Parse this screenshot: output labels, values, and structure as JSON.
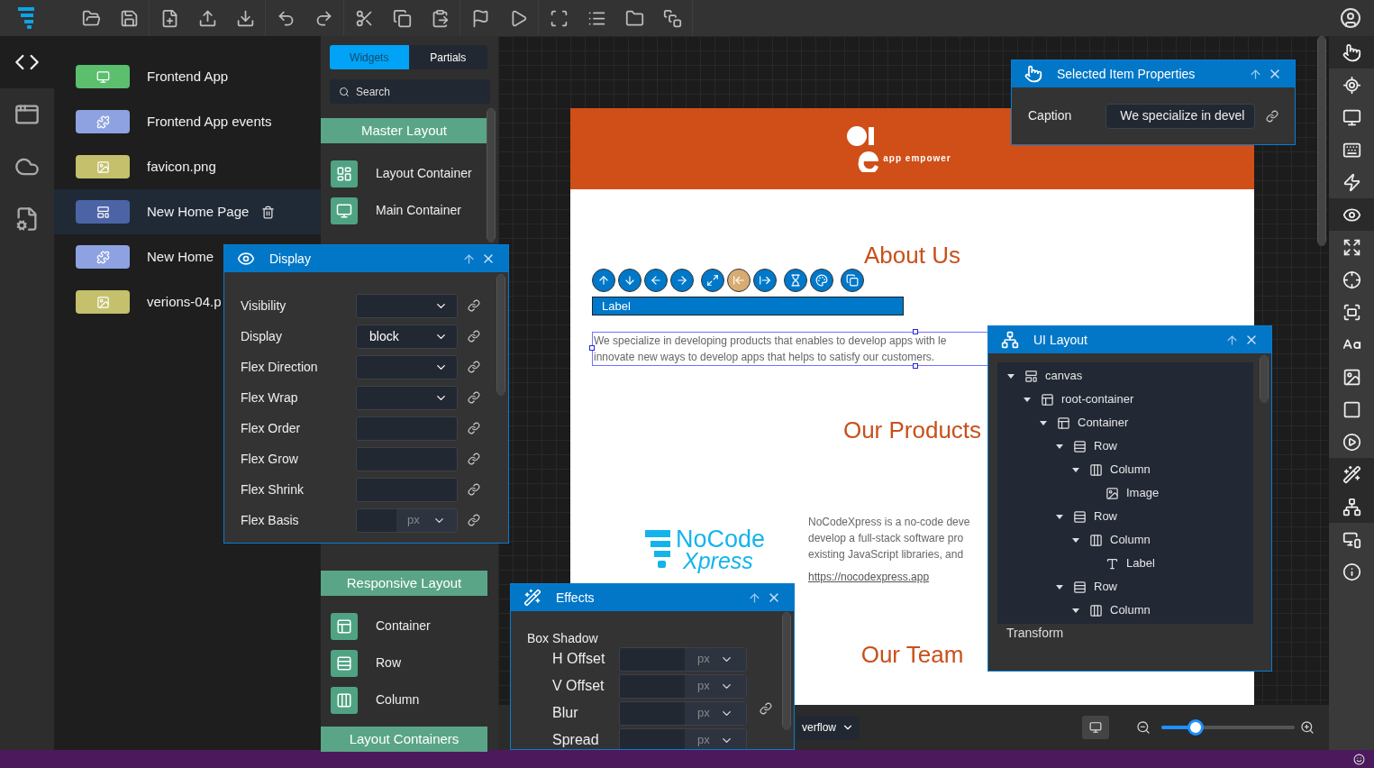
{
  "left_rail": [
    {
      "kind": "code",
      "selected": true
    },
    {
      "kind": "api",
      "selected": false
    },
    {
      "kind": "cloud",
      "selected": false
    },
    {
      "kind": "settings",
      "selected": false
    }
  ],
  "files": [
    {
      "name": "Frontend App",
      "kind": "app",
      "color": "#5cbf6e",
      "selected": false
    },
    {
      "name": "Frontend App events",
      "kind": "events",
      "color": "#8ea2e2",
      "selected": false
    },
    {
      "name": "favicon.png",
      "kind": "image",
      "color": "#c4c06c",
      "selected": false
    },
    {
      "name": "New Home Page",
      "kind": "page",
      "color": "#4c64a6",
      "selected": true
    },
    {
      "name": "New Home",
      "kind": "events",
      "color": "#8ea2e2",
      "selected": false
    },
    {
      "name": "verions-04.p",
      "kind": "image",
      "color": "#c4c06c",
      "selected": false
    }
  ],
  "palette": {
    "tabs": [
      {
        "label": "Widgets",
        "selected": true
      },
      {
        "label": "Partials",
        "selected": false
      }
    ],
    "search": {
      "placeholder": "Search"
    },
    "sections": [
      {
        "title": "Master Layout",
        "items": [
          {
            "label": "Layout Container",
            "kind": "layout"
          },
          {
            "label": "Main Container",
            "kind": "main"
          }
        ]
      },
      {
        "title": "Responsive Layout",
        "items": [
          {
            "label": "Container",
            "kind": "container"
          },
          {
            "label": "Row",
            "kind": "row"
          },
          {
            "label": "Column",
            "kind": "column"
          }
        ]
      },
      {
        "title": "Layout Containers"
      }
    ]
  },
  "page": {
    "brand": "app empower",
    "about_heading": "About Us",
    "element_tools": [
      {
        "kind": "up",
        "active": false
      },
      {
        "kind": "down",
        "active": false
      },
      {
        "kind": "left",
        "active": false
      },
      {
        "kind": "right",
        "active": false
      },
      {
        "kind": "resize",
        "active": false
      },
      {
        "kind": "shrink",
        "active": true
      },
      {
        "kind": "grow",
        "active": false
      },
      {
        "kind": "hourglass",
        "active": false
      },
      {
        "kind": "palette",
        "active": false
      },
      {
        "kind": "copy",
        "active": false
      }
    ],
    "label": "Label",
    "paragraph_lines": [
      "We specialize in developing products that enables to develop apps with le",
      "innovate new ways to develop apps that helps to satisfy our customers."
    ],
    "products_heading": "Our Products",
    "product_logo": {
      "line_1": "NoCode",
      "line_2": "Xpress"
    },
    "description_lines": [
      "NoCodeXpress is a no-code deve",
      "develop a full-stack software pro",
      "existing JavaScript libraries, and"
    ],
    "link": "https://nocodexpress.app",
    "team_heading": "Our Team"
  },
  "bottom_bar": {
    "overflow_select": "verflow",
    "zoom": {
      "level": 0.26
    }
  },
  "right_toolbar": [
    {
      "kind": "pointer",
      "selected": true
    },
    {
      "kind": "rotate",
      "selected": false
    },
    {
      "kind": "monitor",
      "selected": false
    },
    {
      "kind": "keyboard",
      "selected": false
    },
    {
      "kind": "bolt",
      "selected": false
    },
    {
      "kind": "eye",
      "selected": true
    },
    {
      "kind": "expand",
      "selected": false
    },
    {
      "kind": "crosshair",
      "selected": false
    },
    {
      "kind": "frame",
      "selected": false
    },
    {
      "kind": "text",
      "selected": false
    },
    {
      "kind": "image",
      "selected": false
    },
    {
      "kind": "square",
      "selected": false
    },
    {
      "kind": "play",
      "selected": false
    },
    {
      "kind": "wand",
      "selected": true
    },
    {
      "kind": "tree",
      "selected": true
    },
    {
      "kind": "devices",
      "selected": false
    },
    {
      "kind": "info",
      "selected": false
    }
  ],
  "display_panel": {
    "title": "Display",
    "rows": [
      {
        "label": "Visibility",
        "kind": "select"
      },
      {
        "label": "Display",
        "kind": "select",
        "value": "block"
      },
      {
        "label": "Flex Direction",
        "kind": "select"
      },
      {
        "label": "Flex Wrap",
        "kind": "select"
      },
      {
        "label": "Flex Order",
        "kind": "text"
      },
      {
        "label": "Flex Grow",
        "kind": "text"
      },
      {
        "label": "Flex Shrink",
        "kind": "text"
      },
      {
        "label": "Flex Basis",
        "kind": "unit",
        "unit": "px"
      }
    ]
  },
  "effects_panel": {
    "title": "Effects",
    "section": "Box Shadow",
    "rows": [
      {
        "label": "H Offset",
        "unit": "px"
      },
      {
        "label": "V Offset",
        "unit": "px"
      },
      {
        "label": "Blur",
        "unit": "px"
      },
      {
        "label": "Spread",
        "unit": "px"
      }
    ]
  },
  "ui_layout_panel": {
    "title": "UI Layout",
    "tree": [
      {
        "label": "canvas",
        "kind": "canvas",
        "expanded": true,
        "children": [
          {
            "label": "root-container",
            "kind": "container",
            "expanded": true,
            "children": [
              {
                "label": "Container",
                "kind": "container",
                "expanded": true,
                "children": [
                  {
                    "label": "Row",
                    "kind": "row",
                    "expanded": true,
                    "children": [
                      {
                        "label": "Column",
                        "kind": "column",
                        "expanded": true,
                        "children": [
                          {
                            "label": "Image",
                            "kind": "image"
                          }
                        ]
                      }
                    ]
                  },
                  {
                    "label": "Row",
                    "kind": "row",
                    "expanded": true,
                    "children": [
                      {
                        "label": "Column",
                        "kind": "column",
                        "expanded": true,
                        "children": [
                          {
                            "label": "Label",
                            "kind": "label"
                          }
                        ]
                      }
                    ]
                  },
                  {
                    "label": "Row",
                    "kind": "row",
                    "expanded": true,
                    "children": [
                      {
                        "label": "Column",
                        "kind": "column",
                        "expanded": true
                      }
                    ]
                  }
                ]
              }
            ]
          }
        ]
      }
    ],
    "next_section": "Transform"
  },
  "properties_panel": {
    "title": "Selected Item Properties",
    "fields": [
      {
        "label": "Caption",
        "value": "We specialize in devel"
      }
    ]
  }
}
